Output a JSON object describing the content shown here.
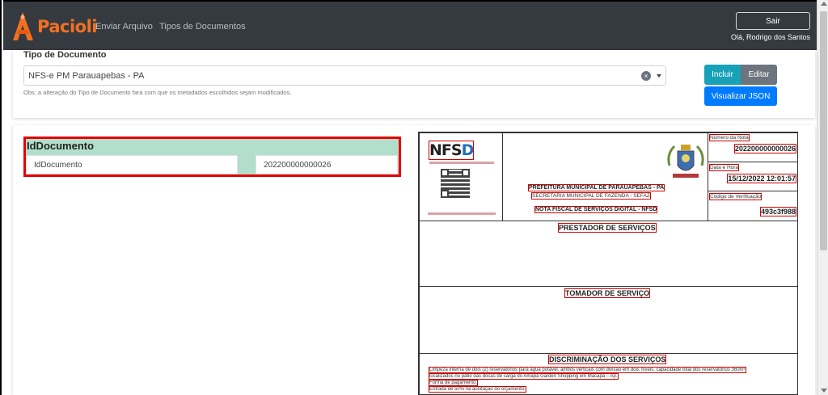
{
  "navbar": {
    "brand": "Pacioli",
    "links": [
      "Enviar Arquivo",
      "Tipos de Documentos"
    ],
    "logout_label": "Sair",
    "user_greeting": "Olá, Rodrigo dos Santos"
  },
  "doc_type": {
    "label": "Tipo de Documento",
    "selected": "NFS-e PM Parauapebas - PA",
    "note": "Obs: a alteração do Tipo de Documento fará com que os metadados escolhidos sejam modificados.",
    "include_label": "Incluir",
    "edit_label": "Editar",
    "json_label": "Visualizar JSON"
  },
  "metadata": {
    "field_title": "IdDocumento",
    "field_name": "IdDocumento",
    "field_value": "202200000000026"
  },
  "preview": {
    "logo_text": "NFS",
    "logo_accent": "D",
    "prefeitura": "PREFEITURA MUNICIPAL DE PARAUAPEBAS - PA",
    "secretaria": "SECRETARIA MUNICIPAL DE FAZENDA - SEFAZ",
    "nota_title": "NOTA FISCAL DE SERVIÇOS DIGITAL - NFSD",
    "numero_label": "Número da Nota",
    "numero_value": "202200000000026",
    "data_label": "Data e Hora",
    "data_value": "15/12/2022 12:01:57",
    "codigo_label": "Código de Verificação",
    "codigo_value": "493c3f988",
    "prestador_title": "PRESTADOR DE SERVIÇOS",
    "tomador_title": "TOMADOR DE SERVIÇO",
    "discriminacao_title": "DISCRIMINAÇÃO DOS SERVIÇOS",
    "desc_line1": "Limpeza interna de dois (2) reservatórios para água potável, ambos verticais com divisão em dois níveis, capacidade total dos reservatórios 360m³",
    "desc_line2": "localizados no pátio das docas de carga do Amapá Garden Shopping em Macapá – Ap.",
    "desc_line3": "Forma de pagamento:",
    "desc_line4": "Entrada de 50% na aceitação do orçamento."
  },
  "colors": {
    "navbar_bg": "#343a40",
    "brand_orange": "#f37021",
    "field_header_bg": "#b2dfcc",
    "highlight_red": "#e60000",
    "btn_include": "#17a2b8",
    "btn_edit": "#6c757d",
    "btn_json": "#007bff"
  }
}
